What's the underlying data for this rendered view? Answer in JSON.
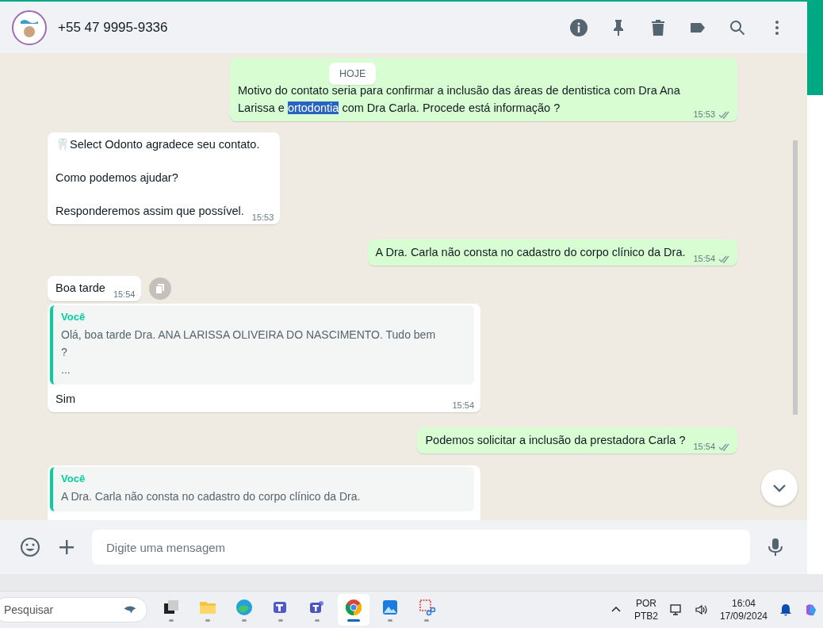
{
  "header": {
    "contact": "+55 47 9995-9336"
  },
  "date_badge": "HOJE",
  "messages": [
    {
      "kind": "out",
      "segments": [
        {
          "text": "Motivo do contato seria para confirmar a inclusão das áreas de dentistica com Dra Ana Larissa e ",
          "selected": false
        },
        {
          "text": "ortodontia",
          "selected": true
        },
        {
          "text": " com Dra Carla. Procede está informação ?",
          "selected": false
        }
      ],
      "time": "15:53",
      "read": false
    },
    {
      "kind": "in",
      "lines": [
        "🦷Select Odonto agradece seu contato.",
        "Como podemos ajudar?",
        "Responderemos assim que possível."
      ],
      "time": "15:53"
    },
    {
      "kind": "out",
      "segments": [
        {
          "text": "A Dra. Carla não consta no cadastro do corpo clínico da Dra.",
          "selected": false
        }
      ],
      "time": "15:54",
      "read": false
    },
    {
      "kind": "in",
      "lines": [
        "Boa tarde"
      ],
      "time": "15:54",
      "forward": true
    },
    {
      "kind": "in",
      "quote": {
        "author": "Você",
        "lines": [
          "Olá, boa tarde Dra. ANA LARISSA OLIVEIRA DO NASCIMENTO. Tudo bem",
          "?",
          "..."
        ]
      },
      "lines": [
        "Sim"
      ],
      "time": "15:54"
    },
    {
      "kind": "out",
      "segments": [
        {
          "text": "Podemos solicitar a inclusão da prestadora Carla ?",
          "selected": false
        }
      ],
      "time": "15:54",
      "read": false
    },
    {
      "kind": "in",
      "quote": {
        "author": "Você",
        "lines": [
          "A Dra. Carla não consta no cadastro do corpo clínico da Dra."
        ]
      }
    }
  ],
  "composer": {
    "placeholder": "Digite uma mensagem"
  },
  "taskbar": {
    "search_placeholder": "Pesquisar",
    "apps": [
      {
        "kind": "taskview",
        "selected": false
      },
      {
        "kind": "folder",
        "selected": false
      },
      {
        "kind": "edge",
        "selected": false
      },
      {
        "kind": "teams",
        "selected": false
      },
      {
        "kind": "teams2",
        "selected": false
      },
      {
        "kind": "chrome",
        "selected": true
      },
      {
        "kind": "photos",
        "selected": false
      },
      {
        "kind": "snip",
        "selected": false
      }
    ],
    "language": "POR",
    "layout": "PTB2",
    "time": "16:04",
    "date": "17/09/2024"
  }
}
